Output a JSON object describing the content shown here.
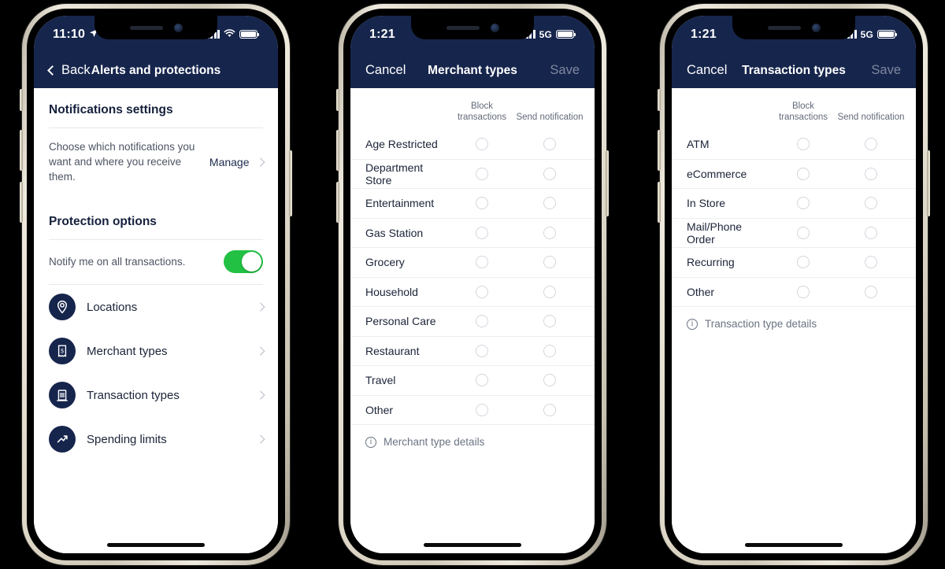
{
  "phones": [
    {
      "id": "alerts-and-protections",
      "status": {
        "time": "11:10",
        "location_icon": "location-arrow-icon",
        "network": "",
        "signal_icon": "cellular-bars-icon",
        "wifi_icon": "wifi-icon",
        "battery_icon": "battery-icon"
      },
      "nav": {
        "back_label": "Back",
        "title": "Alerts and protections"
      },
      "notifications": {
        "section_title": "Notifications settings",
        "description": "Choose which notifications you want and where you receive them.",
        "manage_label": "Manage"
      },
      "protection": {
        "section_title": "Protection options",
        "toggle_label": "Notify me on all transactions.",
        "toggle_state": "on",
        "options": [
          {
            "label": "Locations",
            "icon": "location-pin-icon"
          },
          {
            "label": "Merchant types",
            "icon": "receipt-dollar-icon"
          },
          {
            "label": "Transaction types",
            "icon": "bank-building-icon"
          },
          {
            "label": "Spending limits",
            "icon": "trending-up-arrow-icon"
          }
        ]
      }
    },
    {
      "id": "merchant-types",
      "status": {
        "time": "1:21",
        "network": "5G",
        "signal_icon": "cellular-bars-icon",
        "battery_icon": "battery-icon"
      },
      "nav": {
        "cancel_label": "Cancel",
        "title": "Merchant types",
        "save_label": "Save"
      },
      "columns": [
        "Block transactions",
        "Send notification"
      ],
      "rows": [
        "Age Restricted",
        "Department Store",
        "Entertainment",
        "Gas Station",
        "Grocery",
        "Household",
        "Personal Care",
        "Restaurant",
        "Travel",
        "Other"
      ],
      "details_label": "Merchant type details"
    },
    {
      "id": "transaction-types",
      "status": {
        "time": "1:21",
        "network": "5G",
        "signal_icon": "cellular-bars-icon",
        "battery_icon": "battery-icon"
      },
      "nav": {
        "cancel_label": "Cancel",
        "title": "Transaction types",
        "save_label": "Save"
      },
      "columns": [
        "Block transactions",
        "Send notification"
      ],
      "rows": [
        "ATM",
        "eCommerce",
        "In Store",
        "Mail/Phone Order",
        "Recurring",
        "Other"
      ],
      "details_label": "Transaction type details"
    }
  ],
  "colors": {
    "navy": "#16254c",
    "toggle_on": "#22c043",
    "radio_border": "#d3d6dc",
    "muted_text": "#6b7383",
    "background": "#000000"
  }
}
